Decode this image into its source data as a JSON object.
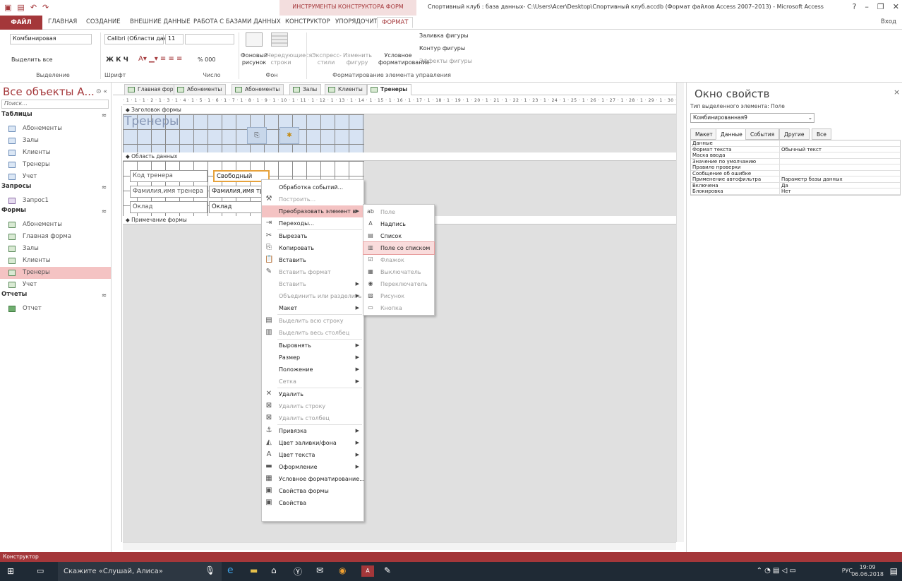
{
  "title_bar": {
    "text": "Спортивный клуб : база данных- C:\\Users\\Acer\\Desktop\\Спортивный клуб.accdb (Формат файлов Access 2007–2013) - Microsoft Access",
    "context_label": "ИНСТРУМЕНТЫ КОНСТРУКТОРА ФОРМ",
    "help": "?",
    "signin": "Вход"
  },
  "ribbon_tabs": [
    "ФАЙЛ",
    "ГЛАВНАЯ",
    "СОЗДАНИЕ",
    "ВНЕШНИЕ ДАННЫЕ",
    "РАБОТА С БАЗАМИ ДАННЫХ",
    "КОНСТРУКТОР",
    "УПОРЯДОЧИТЬ",
    "ФОРМАТ"
  ],
  "ribbon": {
    "selection_combo": "Комбинировая",
    "select_all": "Выделить все",
    "font_name": "Calibri (Области данн",
    "font_size": "11",
    "bold_italic": "Ж К Ч",
    "percent": "% 000",
    "bg_image": "Фоновый рисунок",
    "alt_rows": "Чередующиеся строки",
    "quick_styles": "Экспресс-стили",
    "change_shape": "Изменить фигуру",
    "cond_format": "Условное форматирование",
    "fill": "Заливка фигуры",
    "outline": "Контур фигуры",
    "effects": "Эффекты фигуры",
    "groups": {
      "selection": "Выделение",
      "font": "Шрифт",
      "number": "Число",
      "background": "Фон",
      "control_format": "Форматирование элемента управления"
    }
  },
  "nav": {
    "title": "Все объекты А...",
    "search_placeholder": "Поиск...",
    "sections": [
      {
        "label": "Таблицы",
        "items": [
          "Абонементы",
          "Залы",
          "Клиенты",
          "Тренеры",
          "Учет"
        ]
      },
      {
        "label": "Запросы",
        "items": [
          "Запрос1"
        ]
      },
      {
        "label": "Формы",
        "items": [
          "Абонементы",
          "Главная форма",
          "Залы",
          "Клиенты",
          "Тренеры",
          "Учет"
        ]
      },
      {
        "label": "Отчеты",
        "items": [
          "Отчет"
        ]
      }
    ],
    "selected_item": "Тренеры"
  },
  "doc_tabs": [
    "Главная форма",
    "Абонементы",
    "Абонементы",
    "Залы",
    "Клиенты",
    "Тренеры"
  ],
  "ruler_text": "· 1 · 1 · 1 · 2 · 1 · 3 · 1 · 4 · 1 · 5 · 1 · 6 · 1 · 7 · 1 · 8 · 1 · 9 · 1 · 10 · 1 · 11 · 1 · 12 · 1 · 13 · 1 · 14 · 1 · 15 · 1 · 16 · 1 · 17 · 1 · 18 · 1 · 19 · 1 · 20 · 1 · 21 · 1 · 22 · 1 · 23 · 1 · 24 · 1 · 25 · 1 · 26 · 1 · 27 · 1 · 28 · 1 · 29 · 1 · 30 · 1 · 31 ·",
  "design": {
    "header_section": "Заголовок формы",
    "form_title": "Тренеры",
    "data_section": "Область данных",
    "footer_section": "Примечание формы",
    "labels": [
      "Код тренера",
      "Фамилия,имя тренера",
      "Оклад"
    ],
    "fields": [
      "Свободный",
      "Фамилия,имя тр",
      "Оклад"
    ]
  },
  "context_menu": [
    {
      "label": "Обработка событий...",
      "icon": "events-icon",
      "enabled": true
    },
    {
      "label": "Построить...",
      "icon": "build-icon",
      "enabled": false
    },
    {
      "label": "Преобразовать элемент в",
      "icon": "",
      "enabled": true,
      "submenu": true,
      "active": true
    },
    {
      "label": "Переходы...",
      "icon": "tab-order-icon",
      "enabled": true
    },
    {
      "label": "Вырезать",
      "icon": "cut-icon",
      "enabled": true
    },
    {
      "label": "Копировать",
      "icon": "copy-icon",
      "enabled": true
    },
    {
      "label": "Вставить",
      "icon": "paste-icon",
      "enabled": true
    },
    {
      "label": "Вставить формат",
      "icon": "paste-format-icon",
      "enabled": false
    },
    {
      "label": "Вставить",
      "icon": "",
      "enabled": false,
      "submenu": true
    },
    {
      "label": "Объединить или разделить",
      "icon": "",
      "enabled": false,
      "submenu": true
    },
    {
      "label": "Макет",
      "icon": "",
      "enabled": true,
      "submenu": true
    },
    {
      "label": "Выделить всю строку",
      "icon": "row-icon",
      "enabled": false
    },
    {
      "label": "Выделить весь столбец",
      "icon": "column-icon",
      "enabled": false
    },
    {
      "label": "Выровнять",
      "icon": "",
      "enabled": true,
      "submenu": true
    },
    {
      "label": "Размер",
      "icon": "",
      "enabled": true,
      "submenu": true
    },
    {
      "label": "Положение",
      "icon": "",
      "enabled": true,
      "submenu": true
    },
    {
      "label": "Сетка",
      "icon": "",
      "enabled": false,
      "submenu": true
    },
    {
      "label": "Удалить",
      "icon": "delete-icon",
      "enabled": true
    },
    {
      "label": "Удалить строку",
      "icon": "delete-row-icon",
      "enabled": false
    },
    {
      "label": "Удалить столбец",
      "icon": "delete-column-icon",
      "enabled": false
    },
    {
      "label": "Привязка",
      "icon": "anchor-icon",
      "enabled": true,
      "submenu": true
    },
    {
      "label": "Цвет заливки/фона",
      "icon": "fill-color-icon",
      "enabled": true,
      "submenu": true
    },
    {
      "label": "Цвет текста",
      "icon": "font-color-icon",
      "enabled": true,
      "submenu": true
    },
    {
      "label": "Оформление",
      "icon": "special-effect-icon",
      "enabled": true,
      "submenu": true
    },
    {
      "label": "Условное форматирование...",
      "icon": "conditional-format-icon",
      "enabled": true
    },
    {
      "label": "Свойства формы",
      "icon": "form-properties-icon",
      "enabled": true
    },
    {
      "label": "Свойства",
      "icon": "properties-icon",
      "enabled": true
    }
  ],
  "submenu": [
    {
      "label": "Поле",
      "icon": "textbox-icon",
      "enabled": false
    },
    {
      "label": "Надпись",
      "icon": "label-icon",
      "enabled": true
    },
    {
      "label": "Список",
      "icon": "listbox-icon",
      "enabled": true
    },
    {
      "label": "Поле со списком",
      "icon": "combobox-icon",
      "enabled": true,
      "active": true
    },
    {
      "label": "Флажок",
      "icon": "checkbox-icon",
      "enabled": false
    },
    {
      "label": "Выключатель",
      "icon": "toggle-icon",
      "enabled": false
    },
    {
      "label": "Переключатель",
      "icon": "radio-icon",
      "enabled": false
    },
    {
      "label": "Рисунок",
      "icon": "image-icon",
      "enabled": false
    },
    {
      "label": "Кнопка",
      "icon": "button-icon",
      "enabled": false
    }
  ],
  "properties": {
    "title": "Окно свойств",
    "selection_type": "Тип выделенного элемента: Поле",
    "combo": "Комбинированная9",
    "tabs": [
      "Макет",
      "Данные",
      "События",
      "Другие",
      "Все"
    ],
    "active_tab": "Данные",
    "rows": [
      {
        "k": "Данные",
        "v": ""
      },
      {
        "k": "Формат текста",
        "v": "Обычный текст"
      },
      {
        "k": "Маска ввода",
        "v": ""
      },
      {
        "k": "Значение по умолчанию",
        "v": ""
      },
      {
        "k": "Правило проверки",
        "v": ""
      },
      {
        "k": "Сообщение об ошибке",
        "v": ""
      },
      {
        "k": "Применение автофильтра",
        "v": "Параметр базы данных"
      },
      {
        "k": "Включена",
        "v": "Да"
      },
      {
        "k": "Блокировка",
        "v": "Нет"
      }
    ]
  },
  "status": "Конструктор",
  "taskbar": {
    "search": "Скажите «Слушай, Алиса»",
    "lang": "РУС",
    "time": "19:09",
    "date": "06.06.2018"
  },
  "colors": {
    "accent": "#a4373a",
    "selected": "#f4c3c3"
  }
}
